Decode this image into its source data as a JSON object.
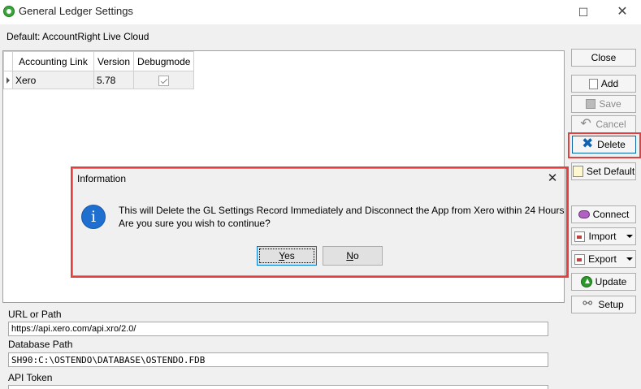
{
  "window": {
    "title": "General Ledger Settings",
    "maximize_glyph": "☐",
    "close_glyph": "✕"
  },
  "default_label": "Default: AccountRight Live Cloud",
  "grid": {
    "columns": [
      "Accounting Link",
      "Version",
      "Debugmode"
    ],
    "rows": [
      {
        "accounting_link": "Xero",
        "version": "5.78",
        "debugmode": true
      }
    ]
  },
  "buttons": {
    "close": "Close",
    "add": "Add",
    "save": "Save",
    "cancel": "Cancel",
    "delete": "Delete",
    "set_default": "Set Default",
    "connect": "Connect",
    "import": "Import",
    "export": "Export",
    "update": "Update",
    "setup": "Setup"
  },
  "fields": {
    "url_label": "URL or Path",
    "url_value": "https://api.xero.com/api.xro/2.0/",
    "db_label": "Database Path",
    "db_value": "SH90:C:\\OSTENDO\\DATABASE\\OSTENDO.FDB",
    "token_label": "API Token",
    "token_value": ""
  },
  "dialog": {
    "title": "Information",
    "close_glyph": "✕",
    "icon": "info-icon",
    "message_line1": "This will Delete the GL Settings Record Immediately and Disconnect the App from Xero within 24 Hours",
    "message_line2": "Are you sure you wish to continue?",
    "yes_mnemonic": "Y",
    "yes_rest": "es",
    "no_mnemonic": "N",
    "no_rest": "o"
  },
  "colors": {
    "highlight": "#e04040",
    "info_blue": "#1f6fd0",
    "delete_icon": "#1060b0"
  }
}
